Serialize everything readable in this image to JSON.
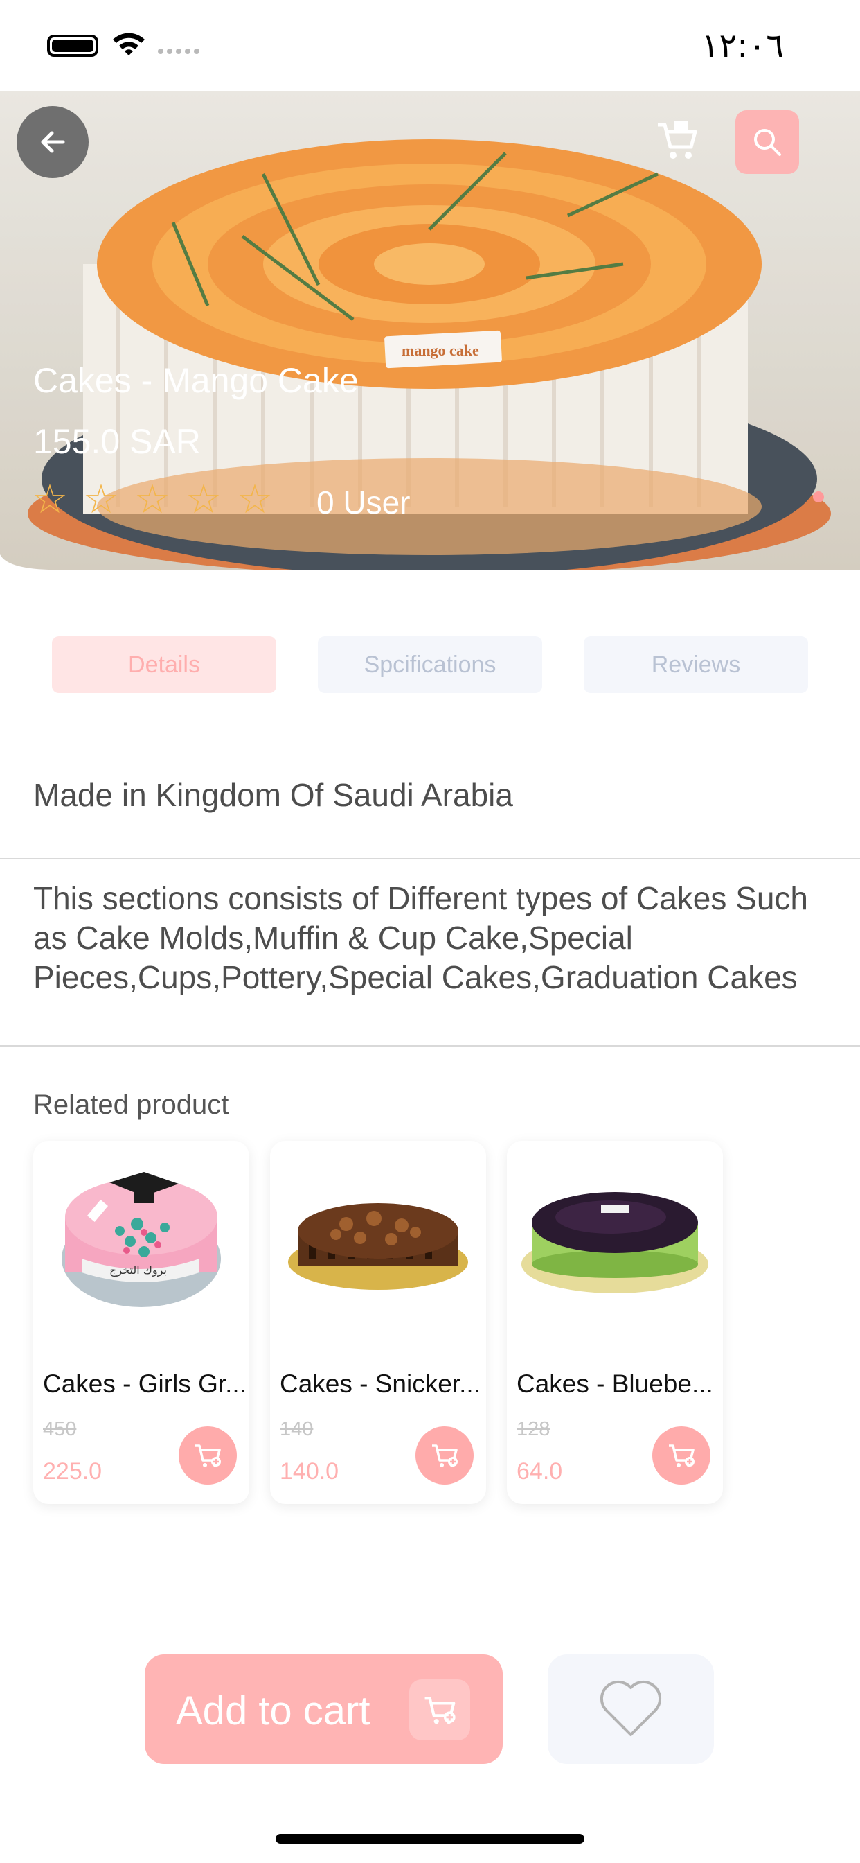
{
  "status_bar": {
    "time": "١٢:٠٦"
  },
  "colors": {
    "accent": "#ffb4b4",
    "accent_light": "#ffe5e5",
    "star": "#f3b54a"
  },
  "header": {
    "back_icon": "arrow-left-icon",
    "cart_icon": "cart-icon",
    "search_icon": "search-icon"
  },
  "product": {
    "image_label": "mango cake",
    "title": "Cakes - Mango Cake",
    "price": "155.0 SAR",
    "rating": 0,
    "rating_max": 5,
    "rating_users": "0 User"
  },
  "tabs": [
    {
      "label": "Details",
      "active": true
    },
    {
      "label": "Spcifications",
      "active": false
    },
    {
      "label": "Reviews",
      "active": false
    }
  ],
  "details": {
    "origin": "Made in Kingdom Of Saudi Arabia",
    "description": "This sections consists of Different types of Cakes Such as Cake Molds,Muffin & Cup Cake,Special Pieces,Cups,Pottery,Special Cakes,Graduation Cakes"
  },
  "related": {
    "title": "Related product",
    "items": [
      {
        "name": "Cakes - Girls Gr...",
        "old_price": "450",
        "price": "225.0",
        "cake_text": "بروك التخرج"
      },
      {
        "name": "Cakes - Snicker...",
        "old_price": "140",
        "price": "140.0"
      },
      {
        "name": "Cakes - Bluebe...",
        "old_price": "128",
        "price": "64.0"
      }
    ]
  },
  "bottom_bar": {
    "add_to_cart": "Add to cart",
    "favorite_icon": "heart-icon"
  }
}
